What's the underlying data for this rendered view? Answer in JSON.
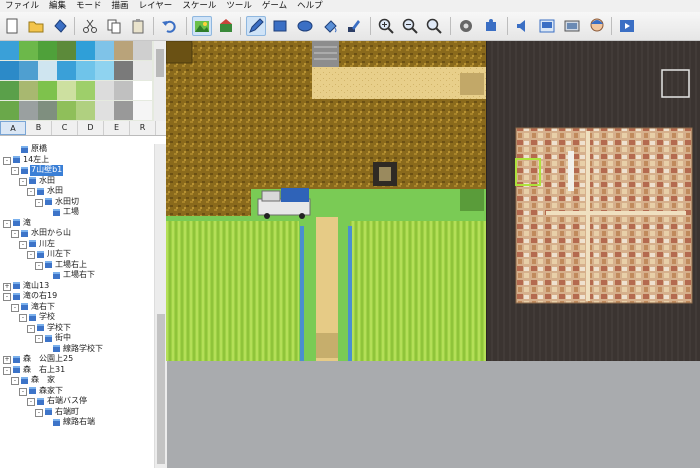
{
  "menu": [
    "ファイル",
    "編集",
    "モード",
    "描画",
    "レイヤー",
    "スケール",
    "ツール",
    "ゲーム",
    "ヘルプ"
  ],
  "palette_tabs": [
    {
      "label": "A",
      "active": true
    },
    {
      "label": "B",
      "active": false
    },
    {
      "label": "C",
      "active": false
    },
    {
      "label": "D",
      "active": false
    },
    {
      "label": "E",
      "active": false
    },
    {
      "label": "R",
      "active": false
    }
  ],
  "map_tree": [
    {
      "label": "原橋",
      "depth": 1,
      "toggle": ""
    },
    {
      "label": "14左上",
      "depth": 0,
      "toggle": "-"
    },
    {
      "label": "7山壁b1",
      "depth": 1,
      "toggle": "-",
      "selected": true
    },
    {
      "label": "水田",
      "depth": 2,
      "toggle": "-"
    },
    {
      "label": "水田",
      "depth": 3,
      "toggle": "-"
    },
    {
      "label": "水田切",
      "depth": 4,
      "toggle": "-"
    },
    {
      "label": "工場",
      "depth": 5,
      "toggle": ""
    },
    {
      "label": "滝",
      "depth": 0,
      "toggle": "-"
    },
    {
      "label": "水田から山",
      "depth": 1,
      "toggle": "-"
    },
    {
      "label": "川左",
      "depth": 2,
      "toggle": "-"
    },
    {
      "label": "川左下",
      "depth": 3,
      "toggle": "-"
    },
    {
      "label": "工場右上",
      "depth": 4,
      "toggle": "-"
    },
    {
      "label": "工場右下",
      "depth": 5,
      "toggle": ""
    },
    {
      "label": "滝山13",
      "depth": 0,
      "toggle": "+"
    },
    {
      "label": "滝の右19",
      "depth": 0,
      "toggle": "-"
    },
    {
      "label": "滝右下",
      "depth": 1,
      "toggle": "-"
    },
    {
      "label": "学校",
      "depth": 2,
      "toggle": "-"
    },
    {
      "label": "学校下",
      "depth": 3,
      "toggle": "-"
    },
    {
      "label": "街中",
      "depth": 4,
      "toggle": "-"
    },
    {
      "label": "線路学校下",
      "depth": 5,
      "toggle": ""
    },
    {
      "label": "森　公園上25",
      "depth": 0,
      "toggle": "+"
    },
    {
      "label": "森　右上31",
      "depth": 0,
      "toggle": "-"
    },
    {
      "label": "森　家",
      "depth": 1,
      "toggle": "-"
    },
    {
      "label": "森家下",
      "depth": 2,
      "toggle": "-"
    },
    {
      "label": "右端バス停",
      "depth": 3,
      "toggle": "-"
    },
    {
      "label": "右端町",
      "depth": 4,
      "toggle": "-"
    },
    {
      "label": "線路右端",
      "depth": 5,
      "toggle": ""
    }
  ],
  "colors": {
    "tree_selected": "#3a7fd6",
    "map_dirt": "#8a6a1c",
    "map_grass": "#79c853",
    "map_rice": "#a9d84a",
    "map_sand": "#e8cf8a",
    "map_dark": "#3b3431"
  },
  "toolbar_icons": [
    "new-icon",
    "open-icon",
    "save-icon",
    "cut-icon",
    "copy-icon",
    "paste-icon",
    "undo-icon",
    "map-layer-icon",
    "event-layer-icon",
    "pencil-icon",
    "rectangle-icon",
    "ellipse-icon",
    "fill-icon",
    "shadow-pen-icon",
    "zoom-in-icon",
    "zoom-out-icon",
    "zoom-actual-icon",
    "database-icon",
    "plugin-icon",
    "sound-test-icon",
    "event-searcher-icon",
    "resource-manager-icon",
    "character-generator-icon",
    "playtest-icon"
  ]
}
